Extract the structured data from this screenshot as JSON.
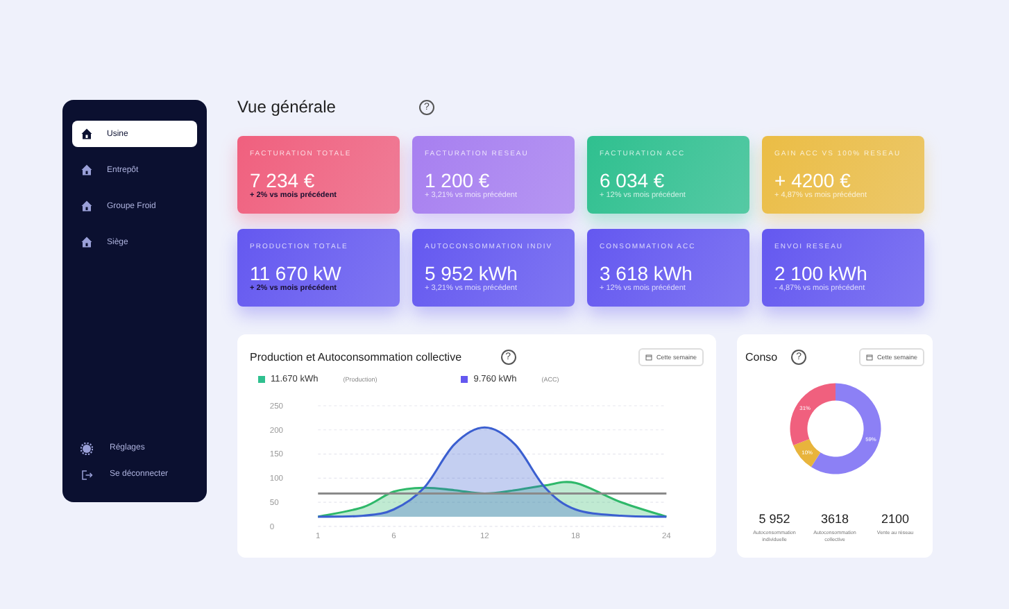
{
  "sidebar": {
    "items": [
      {
        "label": "Usine",
        "selected": true
      },
      {
        "label": "Entrepôt",
        "selected": false
      },
      {
        "label": "Groupe Froid",
        "selected": false
      },
      {
        "label": "Siège",
        "selected": false
      }
    ],
    "footer_items": [
      {
        "kind": "settings",
        "label": "Réglages"
      },
      {
        "kind": "logout",
        "label": "Se déconnecter"
      }
    ]
  },
  "header": {
    "title": "Vue générale",
    "help": "?"
  },
  "kpi_cards": [
    {
      "title": "FACTURATION TOTALE",
      "value": "7 234 €",
      "delta": "+ 2% vs mois précédent",
      "color": "#f0607e",
      "delta_dark": true
    },
    {
      "title": "FACTURATION RESEAU",
      "value": "1 200 €",
      "delta": "+ 3,21% vs mois précédent",
      "color": "#a77ff0",
      "delta_dark": false
    },
    {
      "title": "FACTURATION ACC",
      "value": "6 034 €",
      "delta": "+ 12% vs mois précédent",
      "color": "#2fc08f",
      "delta_dark": false
    },
    {
      "title": "GAIN ACC VS 100% RESEAU",
      "value": "+ 4200 €",
      "delta": "+ 4,87% vs mois précédent",
      "color": "#ebbd45",
      "delta_dark": false
    },
    {
      "title": "PRODUCTION TOTALE",
      "value": "11 670 kW",
      "delta": "+ 2% vs mois précédent",
      "color": "#6458f0",
      "delta_dark": true
    },
    {
      "title": "AUTOCONSOMMATION INDIV",
      "value": "5 952 kWh",
      "delta": "+ 3,21% vs mois précédent",
      "color": "#6458f0",
      "delta_dark": false
    },
    {
      "title": "CONSOMMATION ACC",
      "value": "3 618 kWh",
      "delta": "+ 12% vs mois précédent",
      "color": "#6458f0",
      "delta_dark": false
    },
    {
      "title": "ENVOI RESEAU",
      "value": "2 100 kWh",
      "delta": "- 4,87% vs mois précédent",
      "color": "#6458f0",
      "delta_dark": false
    }
  ],
  "production_panel": {
    "title": "Production et Autoconsommation collective",
    "help": "?",
    "period_button": "Cette semaine",
    "legend": [
      {
        "value": "11.670 kWh",
        "color": "#2fc08f"
      },
      {
        "value": "9.760 kWh",
        "color": "#6458f0"
      }
    ],
    "chart_data": {
      "type": "area",
      "x": [
        1,
        4,
        6,
        8,
        10,
        12,
        14,
        16,
        18,
        21,
        24
      ],
      "series": [
        {
          "name": "(Production)",
          "color": "#2fb86a",
          "values": [
            20,
            40,
            72,
            80,
            75,
            68,
            75,
            85,
            90,
            50,
            20
          ]
        },
        {
          "name": "(ACC)",
          "color": "#3b5fd0",
          "values": [
            20,
            22,
            35,
            80,
            170,
            205,
            170,
            80,
            35,
            22,
            20
          ]
        },
        {
          "type": "line",
          "color": "#8a8a8a",
          "values": [
            68,
            68,
            68,
            68,
            68,
            68,
            68,
            68,
            68,
            68,
            68
          ]
        }
      ],
      "grid": true,
      "xlim": [
        1,
        24
      ],
      "ylim": [
        0,
        250
      ],
      "yticks": [
        0,
        50,
        100,
        150,
        200,
        250
      ],
      "xticks": [
        1,
        6,
        12,
        18,
        24
      ]
    }
  },
  "conso_panel": {
    "title": "Conso",
    "help": "?",
    "period_button": "Cette semaine",
    "chart_data": {
      "type": "donut",
      "values": [
        59,
        10,
        31
      ],
      "value_labels": [
        "59%",
        "10%",
        "31%"
      ],
      "colors": [
        "#8c80f5",
        "#e8b43c",
        "#f0607e"
      ]
    },
    "stats": [
      {
        "value": "5 952",
        "label": "Autoconsommation individuelle"
      },
      {
        "value": "3618",
        "label": "Autoconsommation collective"
      },
      {
        "value": "2100",
        "label": "Vente au réseau"
      }
    ]
  }
}
